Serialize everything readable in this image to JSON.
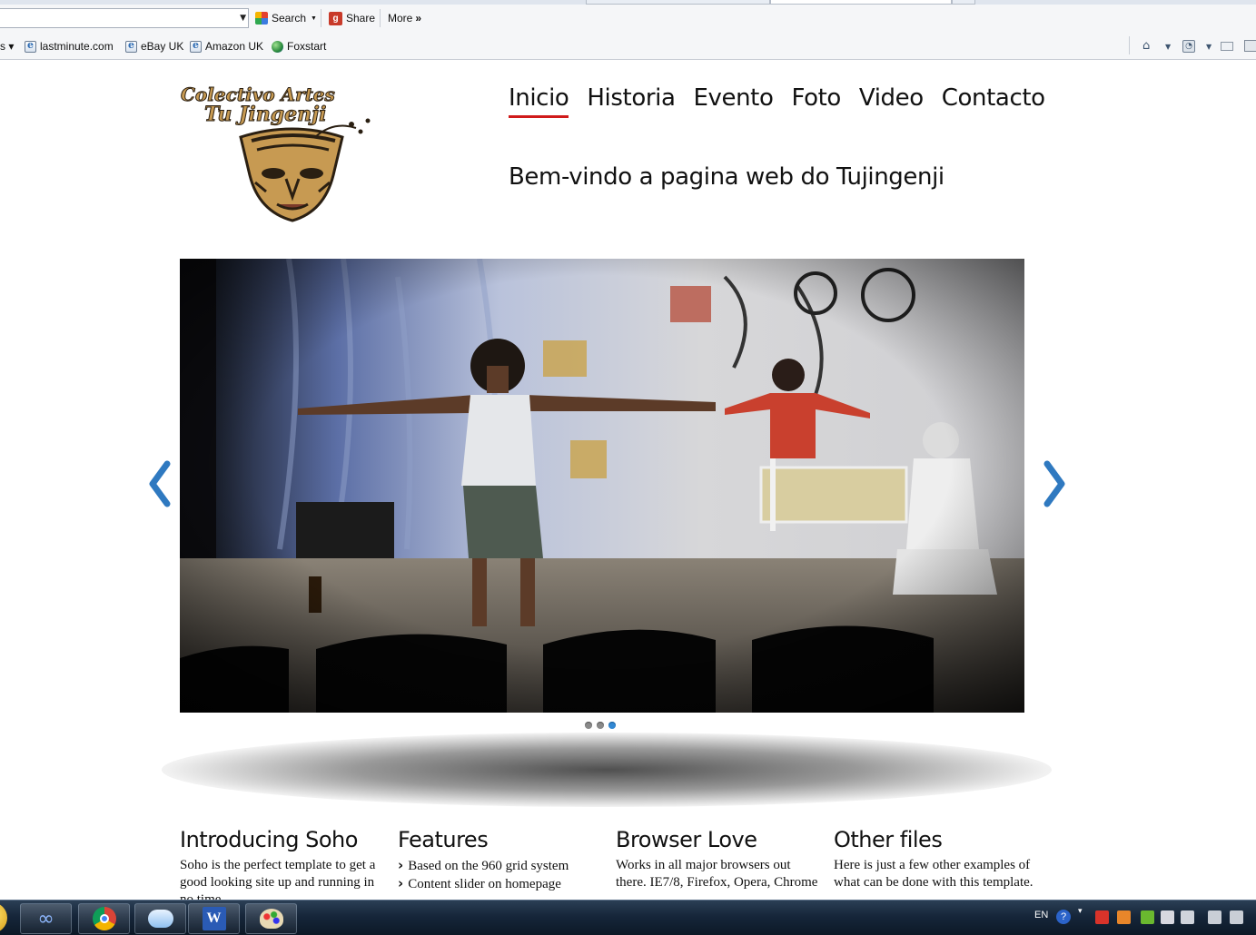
{
  "toolbar": {
    "search_label": "Search",
    "share_label": "Share",
    "more_label": "More"
  },
  "favorites": [
    {
      "label": "lastminute.com"
    },
    {
      "label": "eBay UK"
    },
    {
      "label": "Amazon UK"
    },
    {
      "label": "Foxstart"
    }
  ],
  "logo": {
    "line1": "Colectivo Artes",
    "line2": "Tu Jingenji"
  },
  "nav": {
    "items": [
      {
        "label": "Inicio",
        "active": true
      },
      {
        "label": "Historia",
        "active": false
      },
      {
        "label": "Evento",
        "active": false
      },
      {
        "label": "Foto",
        "active": false
      },
      {
        "label": "Video",
        "active": false
      },
      {
        "label": "Contacto",
        "active": false
      }
    ]
  },
  "welcome_text": "Bem-vindo a pagina web do Tujingenji",
  "slider": {
    "slide_count": 3,
    "active_index": 2
  },
  "columns": [
    {
      "title": "Introducing Soho",
      "text": "Soho is the perfect template to get a good looking site up and running in no time."
    },
    {
      "title": "Features",
      "list": [
        "Based on the 960 grid system",
        "Content slider on homepage"
      ]
    },
    {
      "title": "Browser Love",
      "text": "Works in all major browsers out there. IE7/8, Firefox, Opera, Chrome"
    },
    {
      "title": "Other files",
      "text": "Here is just a few other examples of what can be done with this template."
    }
  ],
  "taskbar": {
    "language": "EN"
  },
  "colors": {
    "nav_active_underline": "#d01a1a",
    "arrow_blue": "#2f79c0",
    "dot_active": "#3288d3",
    "taskbar": "#16263a"
  },
  "icons": [
    "search-engine-icon",
    "share-icon",
    "more-chevron-icon",
    "ie-page-icon",
    "globe-icon",
    "home-icon",
    "rss-icon",
    "mail-icon",
    "print-icon",
    "chrome-icon",
    "word-icon",
    "paint-icon",
    "infinity-icon",
    "weather-icon",
    "help-icon"
  ]
}
